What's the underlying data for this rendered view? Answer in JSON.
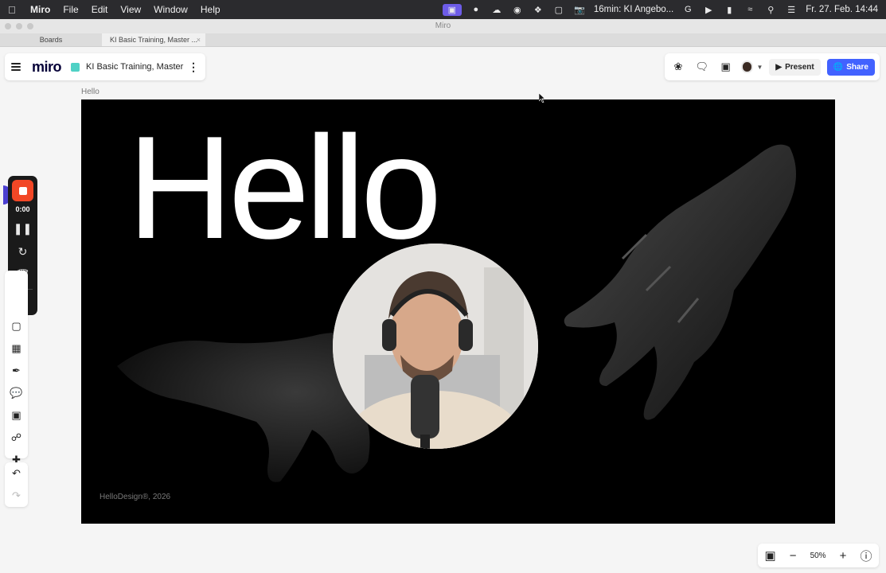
{
  "menubar": {
    "app_name": "Miro",
    "menus": [
      "File",
      "Edit",
      "View",
      "Window",
      "Help"
    ],
    "status_text": "16min:  KI Angebo...",
    "clock": "Fr. 27. Feb.  14:44"
  },
  "window": {
    "title": "Miro",
    "tabs": [
      {
        "label": "Boards"
      },
      {
        "label": "KI Basic Training, Master ..."
      }
    ]
  },
  "board": {
    "logo": "miro",
    "title": "KI Basic Training, Master"
  },
  "toolbar": {
    "present_label": "Present",
    "share_label": "Share"
  },
  "frame": {
    "label": "Hello",
    "headline": "Hello",
    "credit": "HelloDesign®, 2026"
  },
  "recorder": {
    "timer": "0:00"
  },
  "zoom": {
    "level": "50%"
  },
  "colors": {
    "accent": "#4262ff",
    "record": "#f24726",
    "board_icon": "#4fd1c5"
  }
}
